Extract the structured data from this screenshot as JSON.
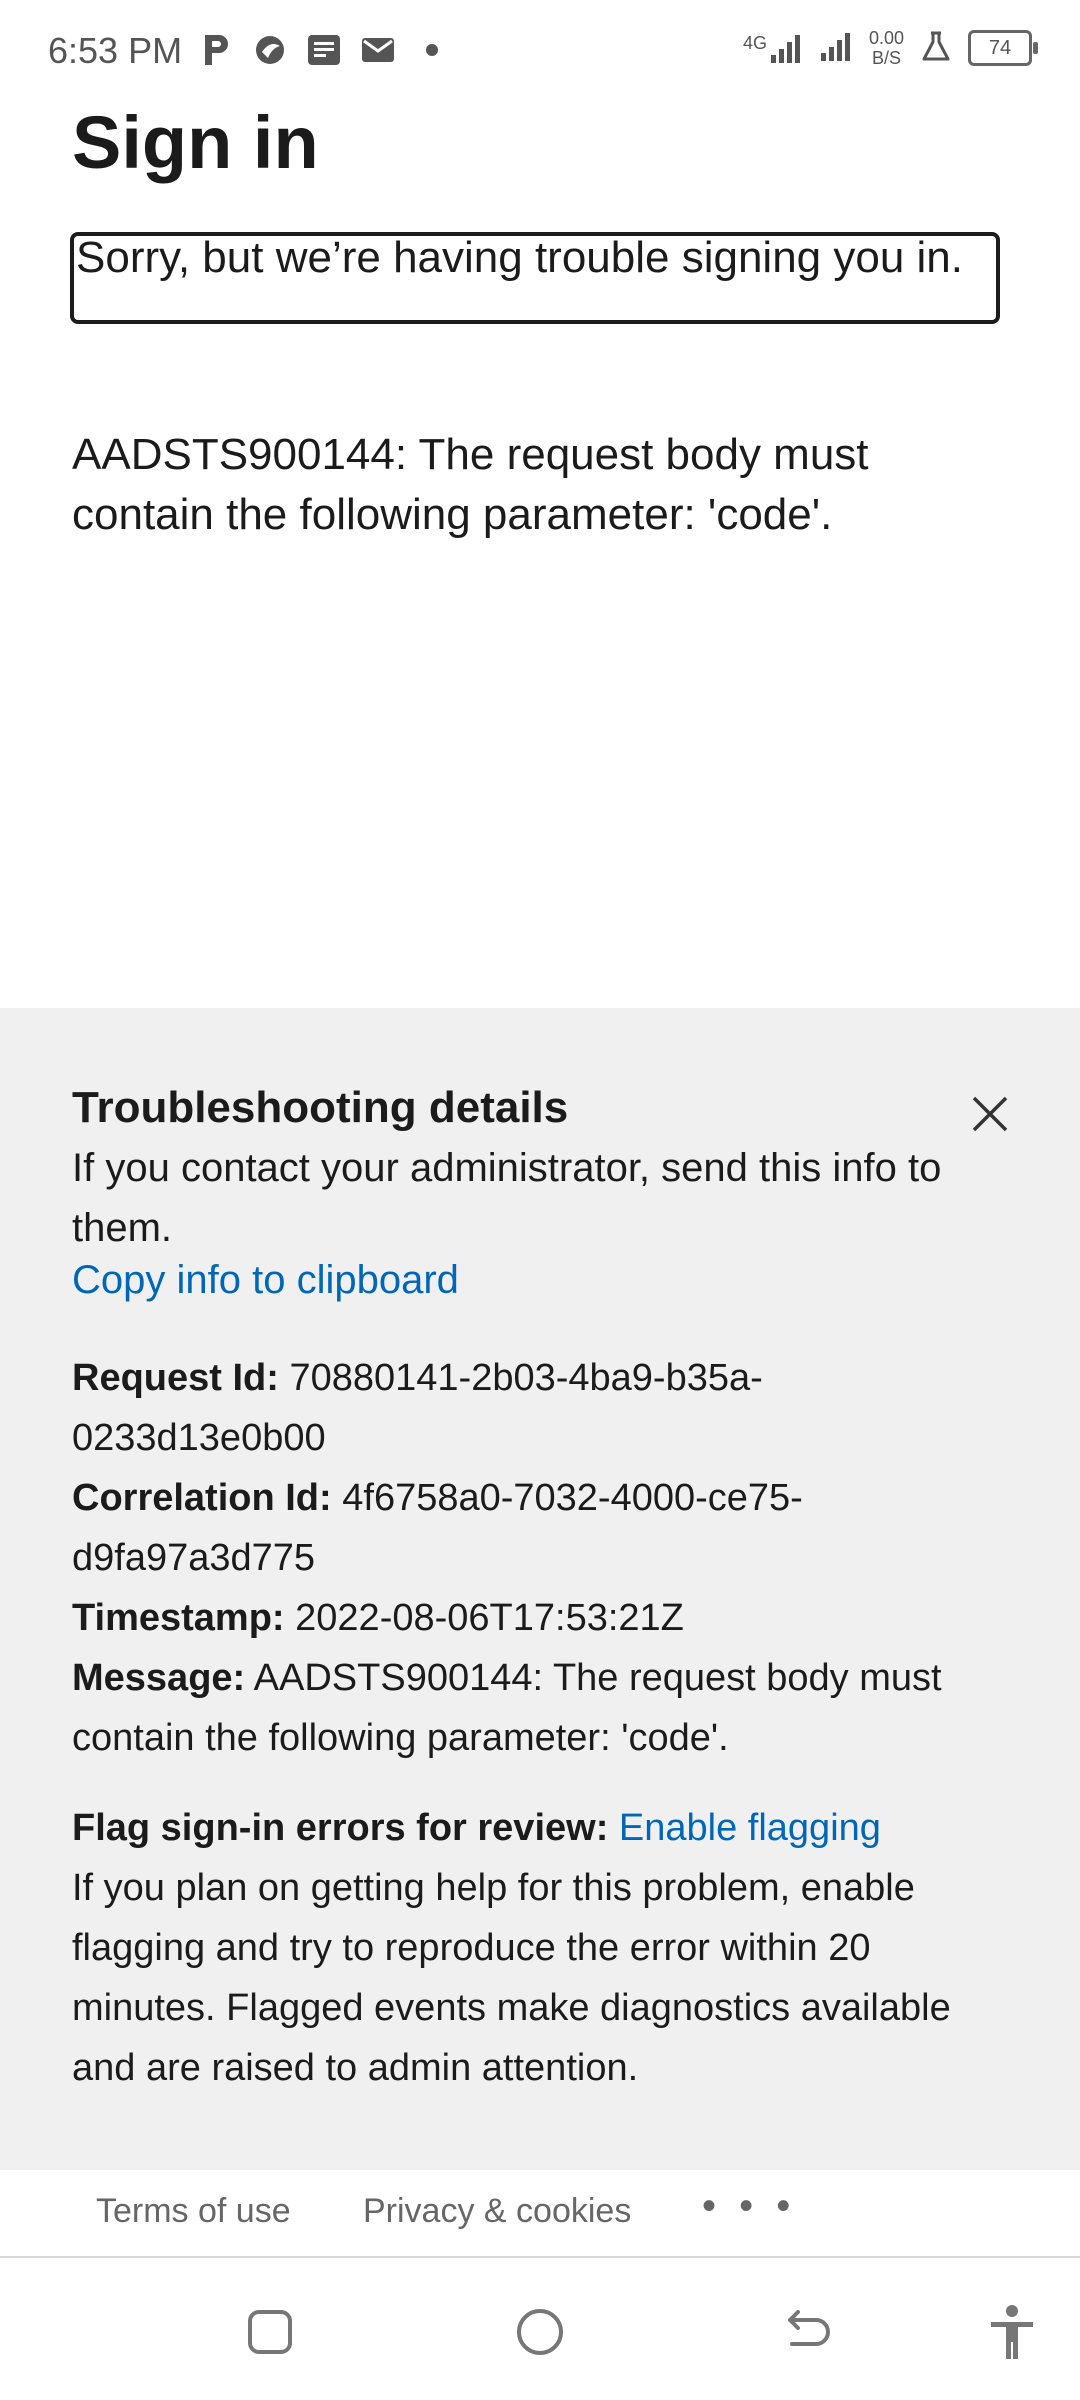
{
  "status_bar": {
    "time": "6:53 PM",
    "left_icons": [
      "parking-icon",
      "bird-icon",
      "news-icon",
      "mail-icon",
      "dot-icon"
    ],
    "network_label": "4G",
    "speed_value": "0.00",
    "speed_unit": "B/S",
    "battery": "74"
  },
  "page": {
    "title": "Sign in",
    "error_box": "Sorry, but we’re having trouble signing you in.",
    "error_message": "AADSTS900144: The request body must contain the following parameter: 'code'."
  },
  "troubleshooting": {
    "title": "Troubleshooting details",
    "intro": "If you contact your administrator, send this info to them.",
    "copy_link": "Copy info to clipboard",
    "request_id_label": "Request Id:",
    "request_id": "70880141-2b03-4ba9-b35a-0233d13e0b00",
    "correlation_id_label": "Correlation Id:",
    "correlation_id": "4f6758a0-7032-4000-ce75-d9fa97a3d775",
    "timestamp_label": "Timestamp:",
    "timestamp": "2022-08-06T17:53:21Z",
    "message_label": "Message:",
    "message": "AADSTS900144: The request body must contain the following parameter: 'code'.",
    "flag_label": "Flag sign-in errors for review:",
    "flag_link": "Enable flagging",
    "flag_desc": "If you plan on getting help for this problem, enable flagging and try to reproduce the error within 20 minutes. Flagged events make diagnostics available and are raised to admin attention."
  },
  "footer": {
    "terms": "Terms of use",
    "privacy": "Privacy & cookies",
    "more": "• • •"
  },
  "colors": {
    "link": "#0067b8",
    "panel_bg": "#f0f0f0",
    "text": "#1b1b1b"
  }
}
